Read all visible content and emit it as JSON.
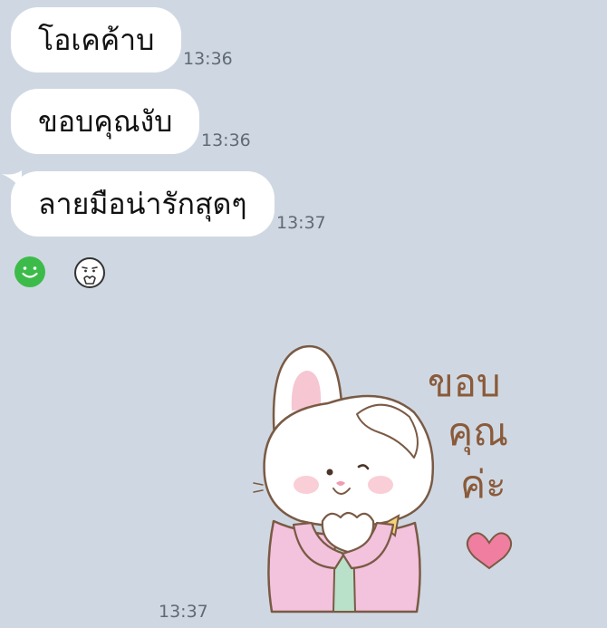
{
  "messages": [
    {
      "text": "โอเคค้าบ",
      "time": "13:36"
    },
    {
      "text": "ขอบคุณงับ",
      "time": "13:36"
    },
    {
      "text": "ลายมือน่ารักสุดๆ",
      "time": "13:37"
    }
  ],
  "sticker": {
    "time": "13:37",
    "caption_lines": [
      "ขอบ",
      "คุณ",
      "ค่ะ"
    ]
  },
  "icons": {
    "reaction": "smiley-reaction-icon",
    "sticker_face": "sticker-preview-face-icon"
  },
  "colors": {
    "background": "#cfd8e2",
    "bubble": "#ffffff",
    "reaction_green": "#3dbb4a",
    "timestamp": "#5f6a76"
  }
}
